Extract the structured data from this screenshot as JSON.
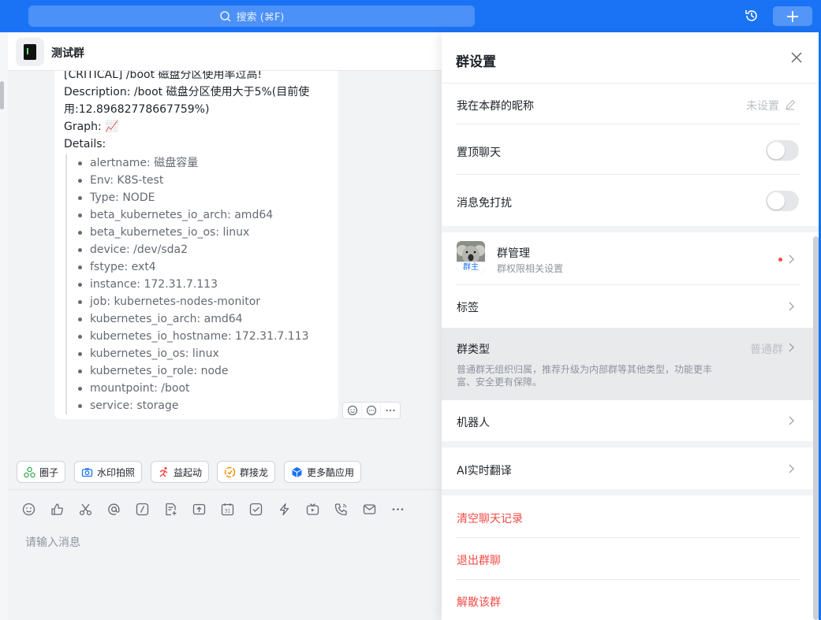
{
  "topbar": {
    "search_placeholder": "搜索 (⌘F)",
    "history_icon": "history-icon",
    "plus_icon": "plus-icon"
  },
  "chat": {
    "group_name": "测试群",
    "message": {
      "title_partial": "[CRITICAL] /boot 磁盘分区使用率过高!",
      "description_line1": "Description: /boot 磁盘分区使用大于5%(目前使",
      "description_line2": "用:12.89682778667759%)",
      "graph_label": "Graph: 📈",
      "details_label": "Details:",
      "details": [
        "alertname: 磁盘容量",
        "Env: K8S-test",
        "Type: NODE",
        "beta_kubernetes_io_arch: amd64",
        "beta_kubernetes_io_os: linux",
        "device: /dev/sda2",
        "fstype: ext4",
        "instance: 172.31.7.113",
        "job: kubernetes-nodes-monitor",
        "kubernetes_io_arch: amd64",
        "kubernetes_io_hostname: 172.31.7.113",
        "kubernetes_io_os: linux",
        "kubernetes_io_role: node",
        "mountpoint: /boot",
        "service: storage"
      ]
    },
    "apps": [
      {
        "label": "圈子",
        "icon": "circle-app-icon",
        "color": "#34a853"
      },
      {
        "label": "水印拍照",
        "icon": "camera-icon",
        "color": "#1a73f5"
      },
      {
        "label": "益起动",
        "icon": "run-icon",
        "color": "#f54a45"
      },
      {
        "label": "群接龙",
        "icon": "relay-icon",
        "color": "#ff8800"
      },
      {
        "label": "更多酷应用",
        "icon": "apps-cube-icon",
        "color": "#1a73f5"
      }
    ],
    "composer_placeholder": "请输入消息"
  },
  "settings": {
    "title": "群设置",
    "nickname_label": "我在本群的昵称",
    "nickname_value": "未设置",
    "pin_label": "置顶聊天",
    "pin_on": false,
    "mute_label": "消息免打扰",
    "mute_on": false,
    "manage_label": "群管理",
    "manage_sub": "群权限相关设置",
    "owner_badge": "群主",
    "tags_label": "标签",
    "type_label": "群类型",
    "type_value": "普通群",
    "type_desc_line1": "普通群无组织归属，推荐升级为内部群等其他类型，功能更丰",
    "type_desc_line2": "富、安全更有保障。",
    "robot_label": "机器人",
    "translate_label": "AI实时翻译",
    "clear_label": "清空聊天记录",
    "exit_label": "退出群聊",
    "dissolve_label": "解散该群",
    "danger_color": "#f54a45",
    "accent_color": "#1a73f5"
  }
}
